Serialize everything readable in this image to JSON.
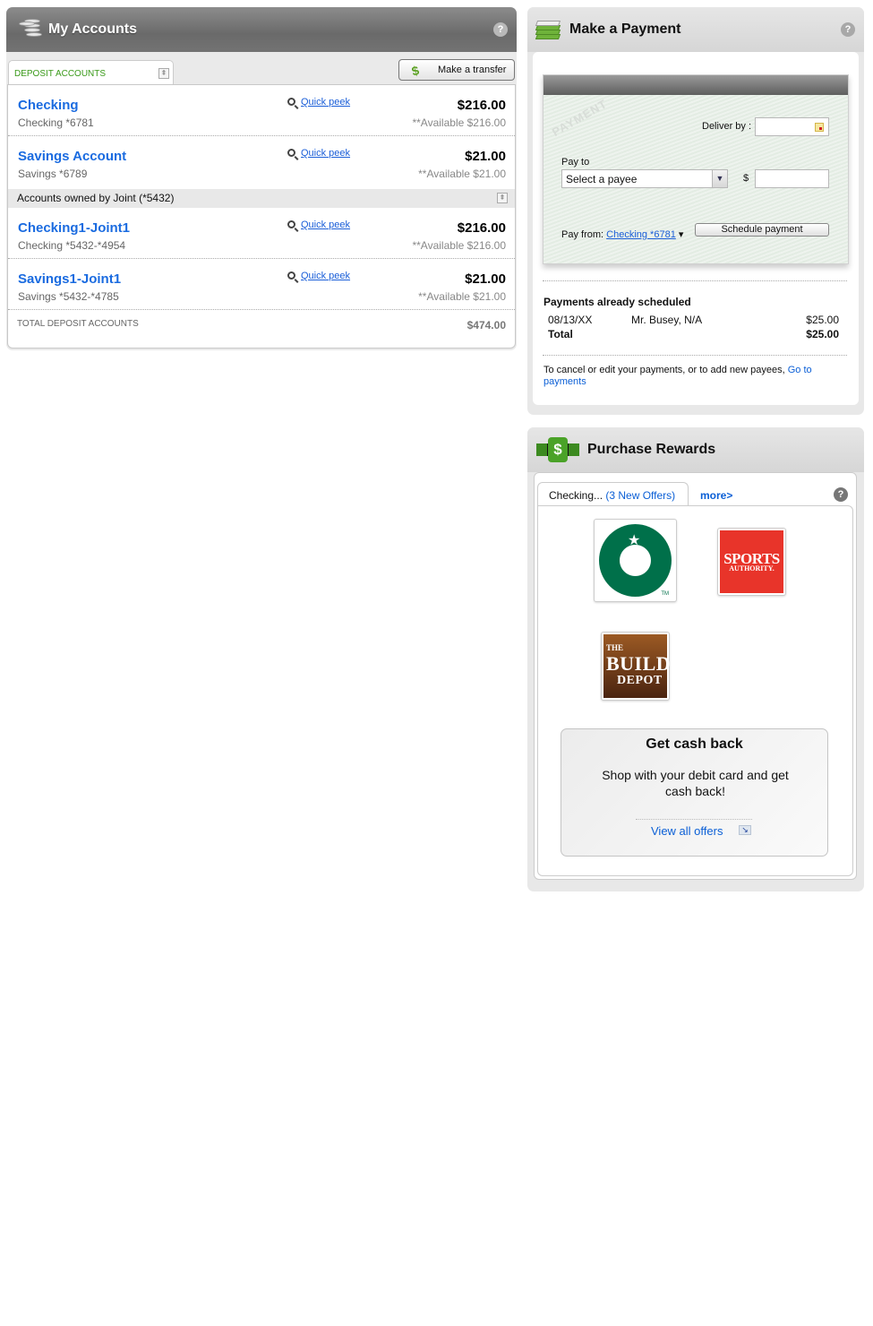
{
  "accounts_panel": {
    "title": "My Accounts",
    "help": "?",
    "tab_label": "DEPOSIT ACCOUNTS",
    "collapse_icon": "⇞",
    "transfer_button": "Make a transfer",
    "transfer_icon": "$",
    "quick_peek_label": "Quick peek",
    "accounts": [
      {
        "name": "Checking",
        "number": "Checking *6781",
        "balance": "$216.00",
        "available": "**Available $216.00"
      },
      {
        "name": "Savings Account",
        "number": "Savings *6789",
        "balance": "$21.00",
        "available": "**Available $21.00"
      }
    ],
    "joint_header": "Accounts owned by Joint (*5432)",
    "joint_accounts": [
      {
        "name": "Checking1-Joint1",
        "number": "Checking *5432-*4954",
        "balance": "$216.00",
        "available": "**Available $216.00"
      },
      {
        "name": "Savings1-Joint1",
        "number": "Savings *5432-*4785",
        "balance": "$21.00",
        "available": "**Available $21.00"
      }
    ],
    "total_label": "TOTAL DEPOSIT ACCOUNTS",
    "total_value": "$474.00"
  },
  "payment_panel": {
    "title": "Make a Payment",
    "help": "?",
    "watermark": "PAYMENT",
    "deliver_by_label": "Deliver by :",
    "deliver_by_value": "",
    "pay_to_label": "Pay to",
    "payee_selected": "Select a payee",
    "payee_chevron": "▼",
    "dollar_sign": "$",
    "amount_value": "",
    "pay_from_label": "Pay from:",
    "pay_from_account": "Checking *6781",
    "pay_from_caret": "▾",
    "schedule_button": "Schedule payment",
    "scheduled_heading": "Payments already scheduled",
    "scheduled": [
      {
        "date": "08/13/XX",
        "payee": "Mr. Busey, N/A",
        "amount": "$25.00"
      }
    ],
    "total_label": "Total",
    "total_value": "$25.00",
    "note_text": "To cancel or edit your payments, or to add new payees, ",
    "note_link": "Go to payments"
  },
  "rewards_panel": {
    "title": "Purchase Rewards",
    "dollar_icon": "$",
    "help": "?",
    "tab_label": "Checking...",
    "tab_offers": "(3 New Offers)",
    "more_link": "more>",
    "merchants": [
      {
        "name": "Starbucks",
        "tm": "TM"
      },
      {
        "name": "Sports Authority",
        "line1": "SPORTS",
        "line2": "AUTHORITY."
      },
      {
        "name": "The Build Depot",
        "line1": "THE",
        "line2": "BUILD",
        "line3": "DEPOT"
      }
    ],
    "cash_back_title": "Get cash back",
    "cash_back_text": "Shop with your debit card and get cash back!",
    "view_offers_link": "View all offers",
    "arrow_icon": "↘"
  }
}
